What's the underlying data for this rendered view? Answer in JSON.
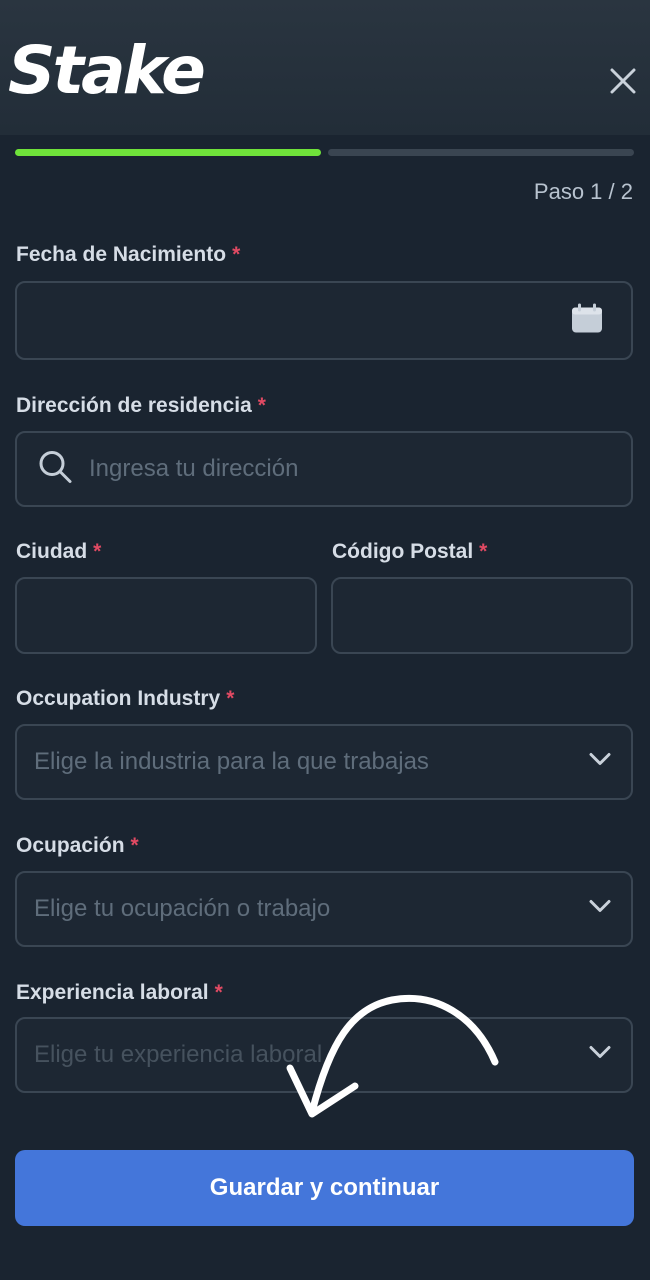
{
  "header": {
    "logo_text": "Stake"
  },
  "progress": {
    "current_step": 1,
    "total_steps": 2,
    "step_label": "Paso 1 / 2"
  },
  "form": {
    "required_mark": "*",
    "birth_date": {
      "label": "Fecha de Nacimiento",
      "icon": "calendar-icon"
    },
    "address": {
      "label": "Dirección de residencia",
      "placeholder": "Ingresa tu dirección",
      "icon": "search-icon"
    },
    "city": {
      "label": "Ciudad"
    },
    "postal_code": {
      "label": "Código Postal"
    },
    "industry": {
      "label": "Occupation Industry",
      "placeholder": "Elige la industria para la que trabajas"
    },
    "occupation": {
      "label": "Ocupación",
      "placeholder": "Elige tu ocupación o trabajo"
    },
    "experience": {
      "label": "Experiencia laboral",
      "placeholder": "Elige tu experiencia laboral"
    }
  },
  "submit_label": "Guardar y continuar",
  "colors": {
    "background": "#1a2430",
    "progress_done": "#6fe23a",
    "required": "#e14a63",
    "button": "#4476da"
  }
}
